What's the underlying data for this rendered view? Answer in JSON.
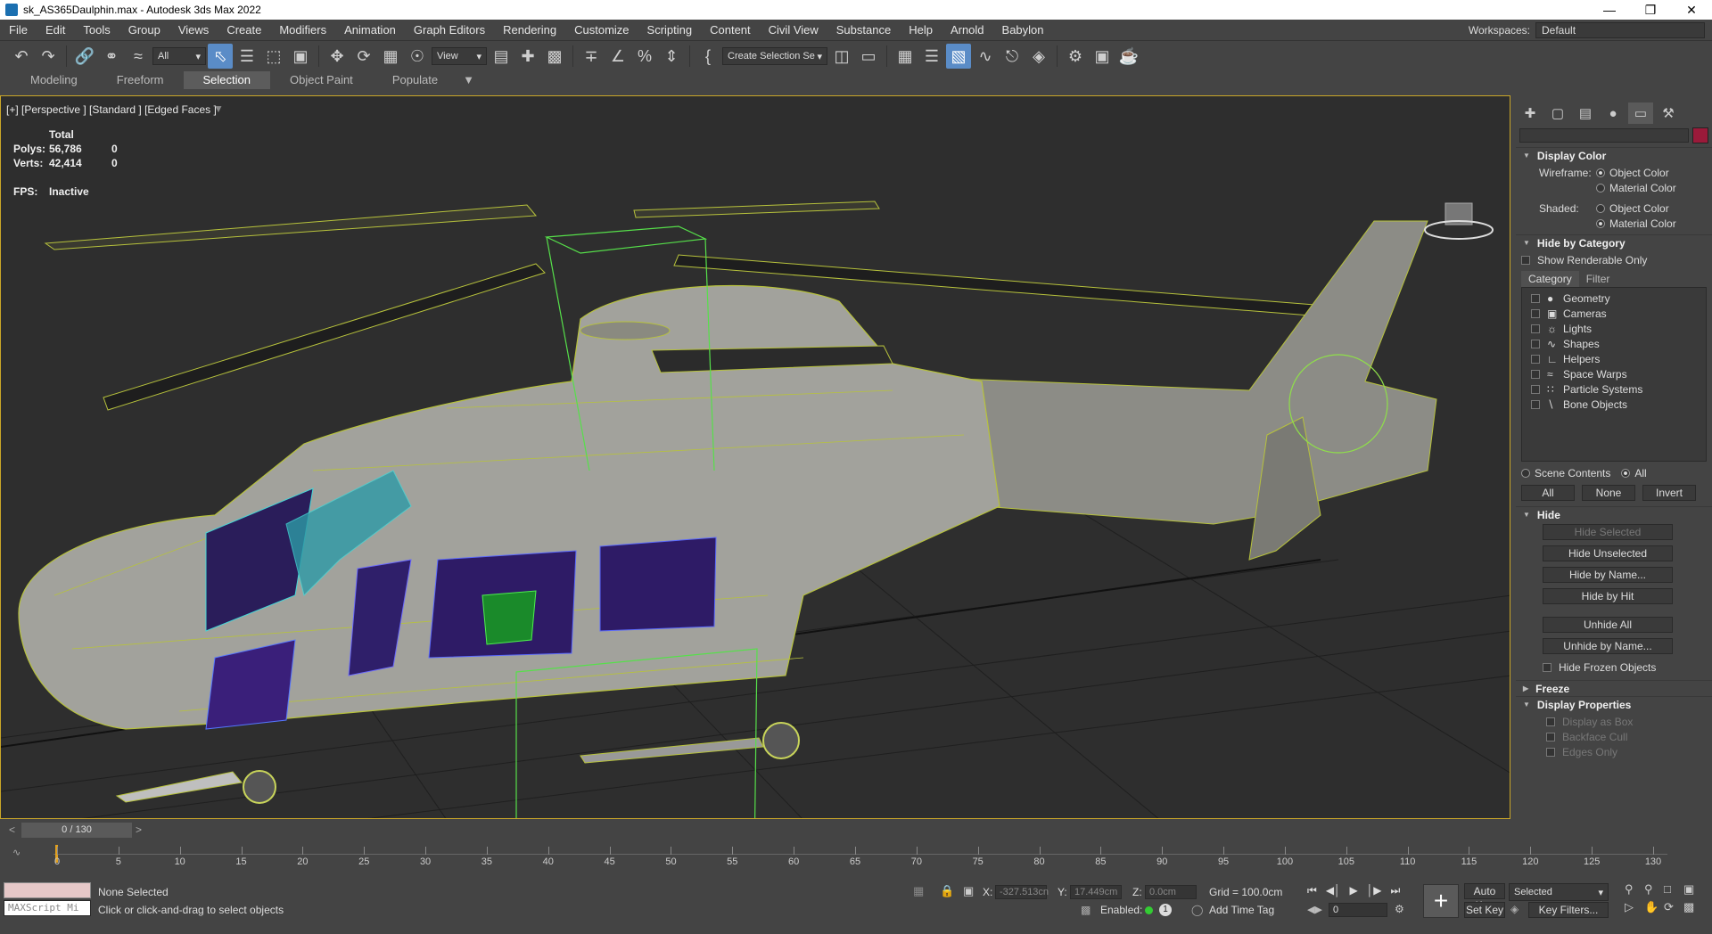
{
  "window": {
    "title": "sk_AS365Daulphin.max - Autodesk 3ds Max 2022",
    "min": "—",
    "max": "❐",
    "close": "✕"
  },
  "menu": [
    "File",
    "Edit",
    "Tools",
    "Group",
    "Views",
    "Create",
    "Modifiers",
    "Animation",
    "Graph Editors",
    "Rendering",
    "Customize",
    "Scripting",
    "Content",
    "Civil View",
    "Substance",
    "Help",
    "Arnold",
    "Babylon"
  ],
  "workspace": {
    "label": "Workspaces:",
    "value": "Default"
  },
  "toolbar": {
    "filter": "All",
    "refcoord": "View",
    "selset": "Create Selection Se"
  },
  "ribbon": {
    "tabs": [
      "Modeling",
      "Freeform",
      "Selection",
      "Object Paint",
      "Populate"
    ],
    "active": 2
  },
  "viewport": {
    "label": "[+] [Perspective ] [Standard ] [Edged Faces ]",
    "stats": {
      "total": "Total",
      "polys_label": "Polys:",
      "polys": "56,786",
      "polys_sel": "0",
      "verts_label": "Verts:",
      "verts": "42,414",
      "verts_sel": "0",
      "fps_label": "FPS:",
      "fps": "Inactive"
    }
  },
  "panel": {
    "display_color": {
      "title": "Display Color",
      "wireframe": "Wireframe:",
      "shaded": "Shaded:",
      "object_color": "Object Color",
      "material_color": "Material Color"
    },
    "hide_by_category": {
      "title": "Hide by Category",
      "show_renderable": "Show Renderable Only",
      "tabs": [
        "Category",
        "Filter"
      ],
      "items": [
        "Geometry",
        "Cameras",
        "Lights",
        "Shapes",
        "Helpers",
        "Space Warps",
        "Particle Systems",
        "Bone Objects"
      ],
      "scene_contents": "Scene Contents",
      "all_radio": "All",
      "buttons": [
        "All",
        "None",
        "Invert"
      ]
    },
    "hide": {
      "title": "Hide",
      "buttons": [
        "Hide Selected",
        "Hide Unselected",
        "Hide by Name...",
        "Hide by Hit"
      ],
      "buttons2": [
        "Unhide All",
        "Unhide by Name..."
      ],
      "frozen": "Hide Frozen Objects"
    },
    "freeze": {
      "title": "Freeze"
    },
    "display_props": {
      "title": "Display Properties",
      "items": [
        "Display as Box",
        "Backface Cull",
        "Edges Only"
      ]
    }
  },
  "timeline": {
    "frame": "0 / 130",
    "ticks": [
      "0",
      "5",
      "10",
      "15",
      "20",
      "25",
      "30",
      "35",
      "40",
      "45",
      "50",
      "55",
      "60",
      "65",
      "70",
      "75",
      "80",
      "85",
      "90",
      "95",
      "100",
      "105",
      "110",
      "115",
      "120",
      "125",
      "130"
    ]
  },
  "status": {
    "maxscript": "MAXScript Mi",
    "none_selected": "None Selected",
    "hint": "Click or click-and-drag to select objects",
    "x_label": "X:",
    "x": "-327.513cn",
    "y_label": "Y:",
    "y": "17.449cm",
    "z_label": "Z:",
    "z": "0.0cm",
    "grid": "Grid = 100.0cm",
    "enabled": "Enabled:",
    "add_time_tag": "Add Time Tag",
    "auto_key": "Auto Key",
    "set_key": "Set Key",
    "selected": "Selected",
    "key_filters": "Key Filters...",
    "frame_value": "0"
  }
}
